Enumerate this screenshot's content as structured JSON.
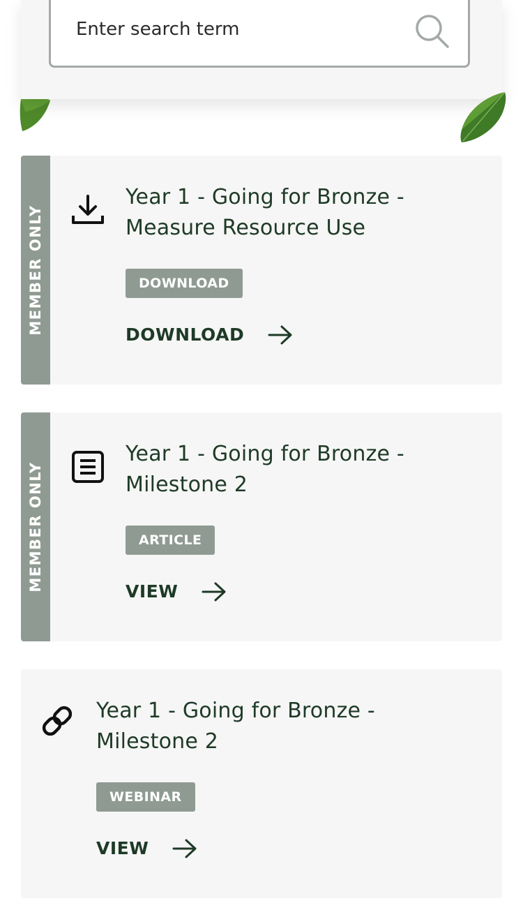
{
  "search": {
    "placeholder": "Enter search term",
    "button_icon": "search-icon"
  },
  "colors": {
    "dark_green": "#1e3a26",
    "grey_tag": "#8f9a93",
    "card_bg": "#f6f6f6",
    "search_border": "#a3aaa5"
  },
  "resources": [
    {
      "member_label": "MEMBER ONLY",
      "icon": "download-icon",
      "title": "Year 1 - Going for Bronze - Measure Resource Use",
      "tag": "DOWNLOAD",
      "action_label": "DOWNLOAD",
      "action_icon": "arrow-right-icon"
    },
    {
      "member_label": "MEMBER ONLY",
      "icon": "article-icon",
      "title": "Year 1 - Going for Bronze - Milestone 2",
      "tag": "ARTICLE",
      "action_label": "VIEW",
      "action_icon": "arrow-right-icon"
    },
    {
      "icon": "link-icon",
      "title": "Year 1 - Going for Bronze - Milestone 2",
      "tag": "WEBINAR",
      "action_label": "VIEW",
      "action_icon": "arrow-right-icon"
    }
  ]
}
